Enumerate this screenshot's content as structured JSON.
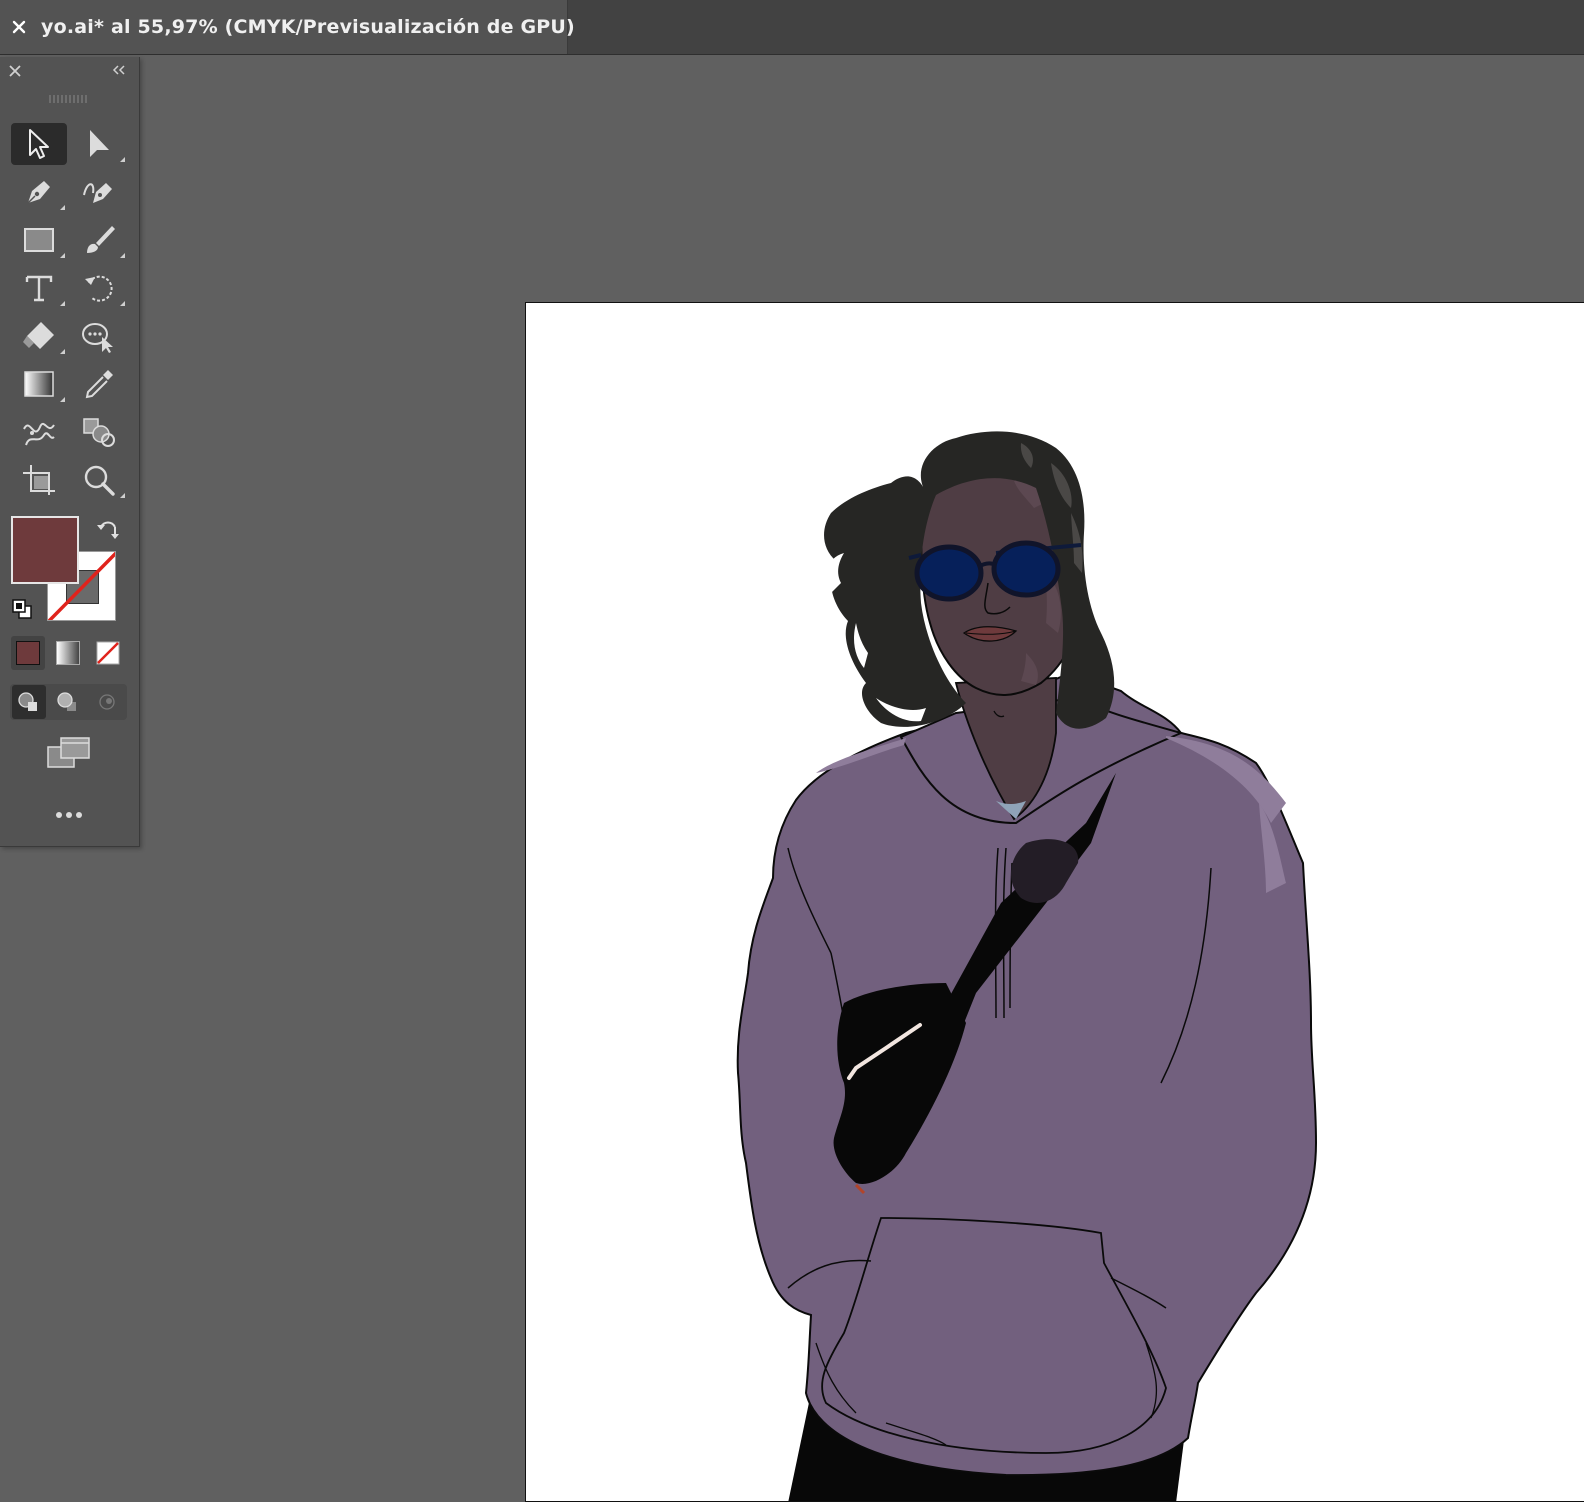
{
  "document_tab": {
    "title": "yo.ai* al 55,97% (CMYK/Previsualización de GPU)"
  },
  "tools_panel": {
    "tools": [
      "selection-tool",
      "direct-selection-tool",
      "pen-tool",
      "curvature-tool",
      "rectangle-tool",
      "paintbrush-tool",
      "type-tool",
      "rotate-tool",
      "eraser-tool",
      "puppet-warp-tool",
      "gradient-tool",
      "eyedropper-tool",
      "blend-tool",
      "shape-builder-tool",
      "artboard-tool",
      "zoom-tool"
    ],
    "active_tool": "selection-tool"
  },
  "colors": {
    "fill": "#6e3a3c",
    "stroke": "none",
    "panel_bg": "#535353",
    "canvas_bg": "#606060",
    "hoodie": "#72607e",
    "skin": "#4f3d44",
    "hair": "#262624",
    "glasses_lens": "#06205a"
  },
  "color_modes": [
    "color",
    "gradient",
    "none"
  ],
  "draw_modes": [
    "draw-normal",
    "draw-behind",
    "draw-inside"
  ]
}
